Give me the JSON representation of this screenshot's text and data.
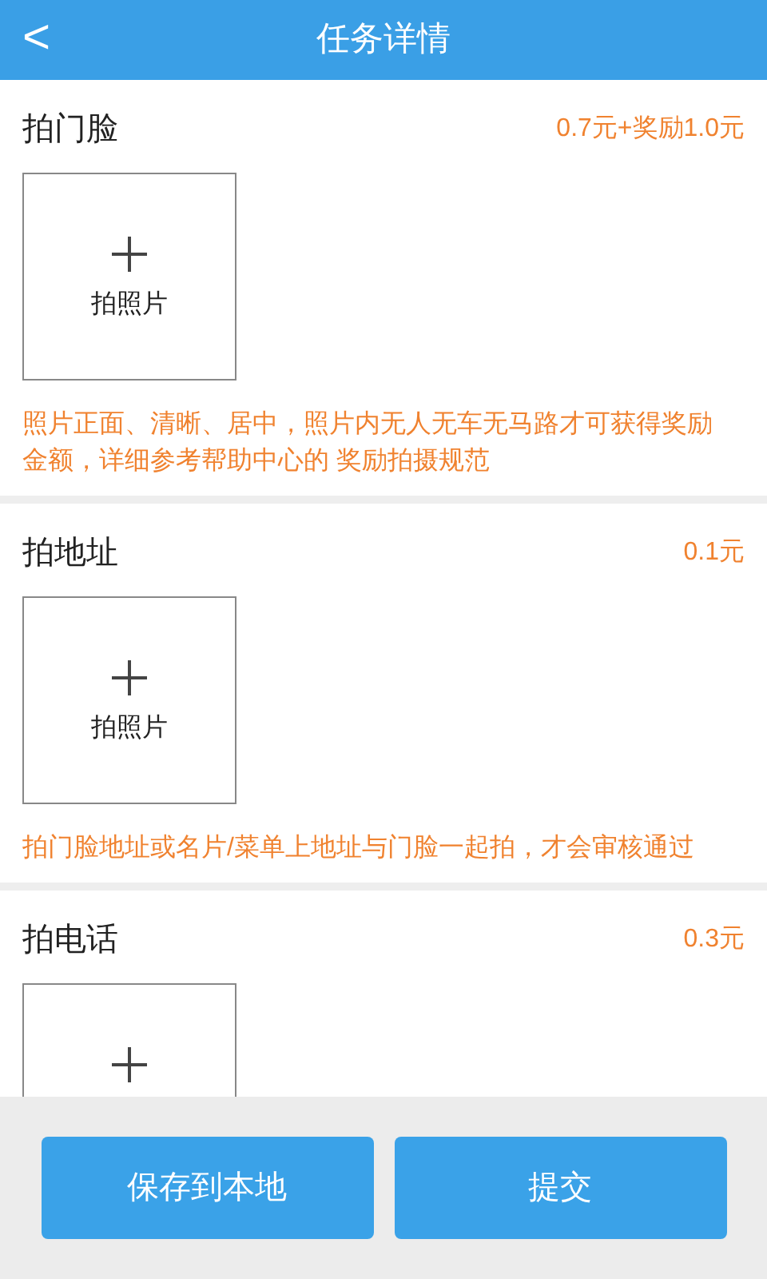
{
  "header": {
    "back": "<",
    "title": "任务详情"
  },
  "tasks": [
    {
      "title": "拍门脸",
      "reward": "0.7元+奖励1.0元",
      "photo_label": "拍照片",
      "hint": "照片正面、清晰、居中，照片内无人无车无马路才可获得奖励金额，详细参考帮助中心的 奖励拍摄规范"
    },
    {
      "title": "拍地址",
      "reward": "0.1元",
      "photo_label": "拍照片",
      "hint": "拍门脸地址或名片/菜单上地址与门脸一起拍，才会审核通过"
    },
    {
      "title": "拍电话",
      "reward": "0.3元"
    }
  ],
  "buttons": [
    "保存到本地",
    "提交"
  ]
}
